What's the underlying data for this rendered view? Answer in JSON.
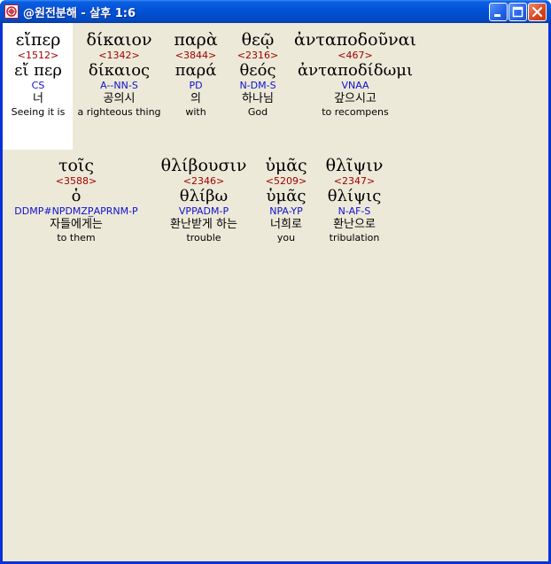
{
  "window": {
    "title": "@원전분해 - 살후 1:6"
  },
  "verse_rows": [
    [
      {
        "greek": "εἴπερ",
        "strong": "<1512>",
        "lemma": "εἴ περ",
        "parse": "CS",
        "korean": "너",
        "english": "Seeing it is"
      },
      {
        "greek": "δίκαιον",
        "strong": "<1342>",
        "lemma": "δίκαιος",
        "parse": "A--NN-S",
        "korean": "공의시",
        "english": "a righteous thing"
      },
      {
        "greek": "παρὰ",
        "strong": "<3844>",
        "lemma": "παρά",
        "parse": "PD",
        "korean": "의",
        "english": "with"
      },
      {
        "greek": "θεῷ",
        "strong": "<2316>",
        "lemma": "θεός",
        "parse": "N-DM-S",
        "korean": "하나님",
        "english": "God"
      },
      {
        "greek": "ἀνταποδοῦναι",
        "strong": "<467>",
        "lemma": "ἀνταποδίδωμι",
        "parse": "VNAA",
        "korean": "갚으시고",
        "english": "to recompens"
      }
    ],
    [
      {
        "greek": "τοῖς",
        "strong": "<3588>",
        "lemma": "ὁ",
        "parse": "DDMP#NPDMZP̲APRNM-P",
        "korean": "자들에게는",
        "english": "to them"
      },
      {
        "greek": "θλίβουσιν",
        "strong": "<2346>",
        "lemma": "θλίβω",
        "parse": "VPPADM-P",
        "korean": "환난받게 하는",
        "english": "trouble"
      },
      {
        "greek": "ὑμᾶς",
        "strong": "<5209>",
        "lemma": "ὑμᾶς",
        "parse": "NPA-YP",
        "korean": "너희로",
        "english": "you"
      },
      {
        "greek": "θλῖψιν",
        "strong": "<2347>",
        "lemma": "θλίψις",
        "parse": "N-AF-S",
        "korean": "환난으로",
        "english": "tribulation"
      }
    ]
  ],
  "colors": {
    "strong": "#a00000",
    "parse": "#1010d0",
    "client_bg": "#ece9d8",
    "titlebar": "#0453d8"
  },
  "icons": [
    "app-icon",
    "minimize-icon",
    "maximize-icon",
    "close-icon"
  ]
}
